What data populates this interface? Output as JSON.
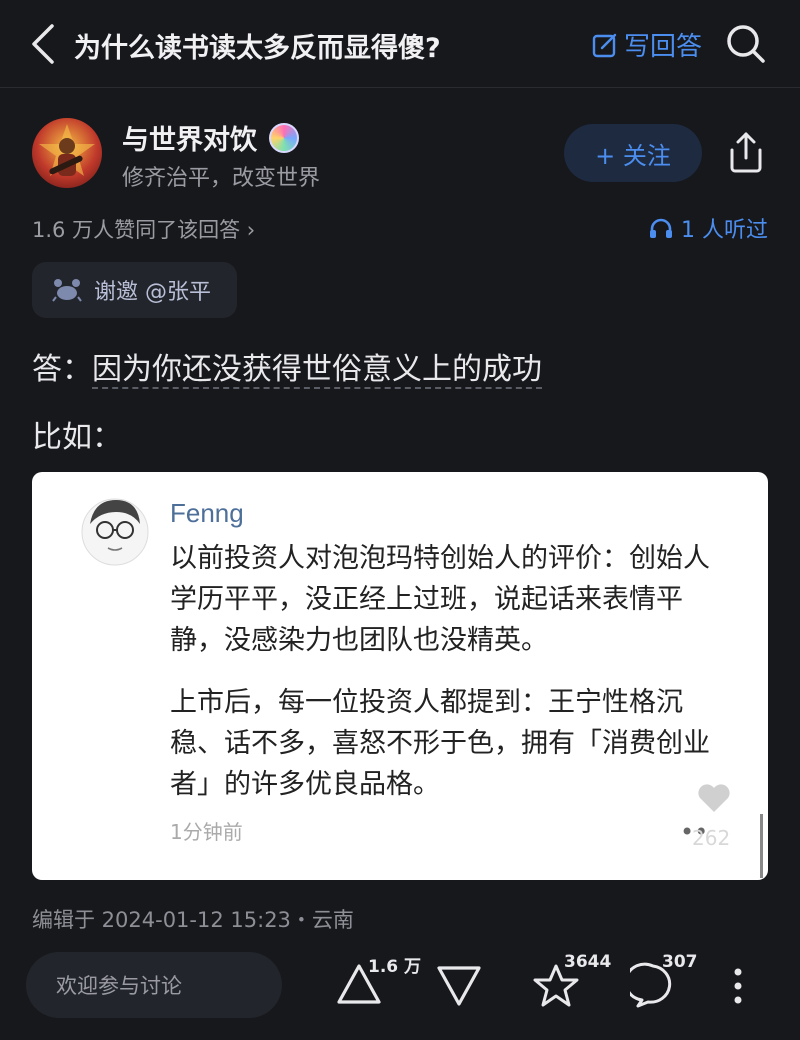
{
  "header": {
    "question_title": "为什么读书读太多反而显得傻?",
    "write_answer_label": "写回答"
  },
  "author": {
    "name": "与世界对饮",
    "bio": "修齐治平，改变世界",
    "follow_label": "+ 关注"
  },
  "stats": {
    "upvote_text": "1.6 万人赞同了该回答 ›",
    "listen_text": "1 人听过"
  },
  "invite": {
    "label": "谢邀 @张平"
  },
  "answer": {
    "prefix": "答：",
    "highlight": "因为你还没获得世俗意义上的成功",
    "example_label": "比如："
  },
  "quote_card": {
    "name": "Fenng",
    "paragraph1": "以前投资人对泡泡玛特创始人的评价：创始人学历平平，没正经上过班，说起话来表情平静，没感染力也团队也没精英。",
    "paragraph2": "上市后，每一位投资人都提到：王宁性格沉稳、话不多，喜怒不形于色，拥有「消费创业者」的许多优良品格。",
    "time": "1分钟前",
    "likes": "262",
    "dots": "••"
  },
  "edit_info": "编辑于 2024-01-12 15:23・云南",
  "bottom_bar": {
    "comment_placeholder": "欢迎参与讨论",
    "upvote_count": "1.6 万",
    "favorite_count": "3644",
    "comment_count": "307"
  },
  "colors": {
    "background": "#17181c",
    "accent": "#4b8ef0",
    "muted": "#9b9ca3"
  }
}
